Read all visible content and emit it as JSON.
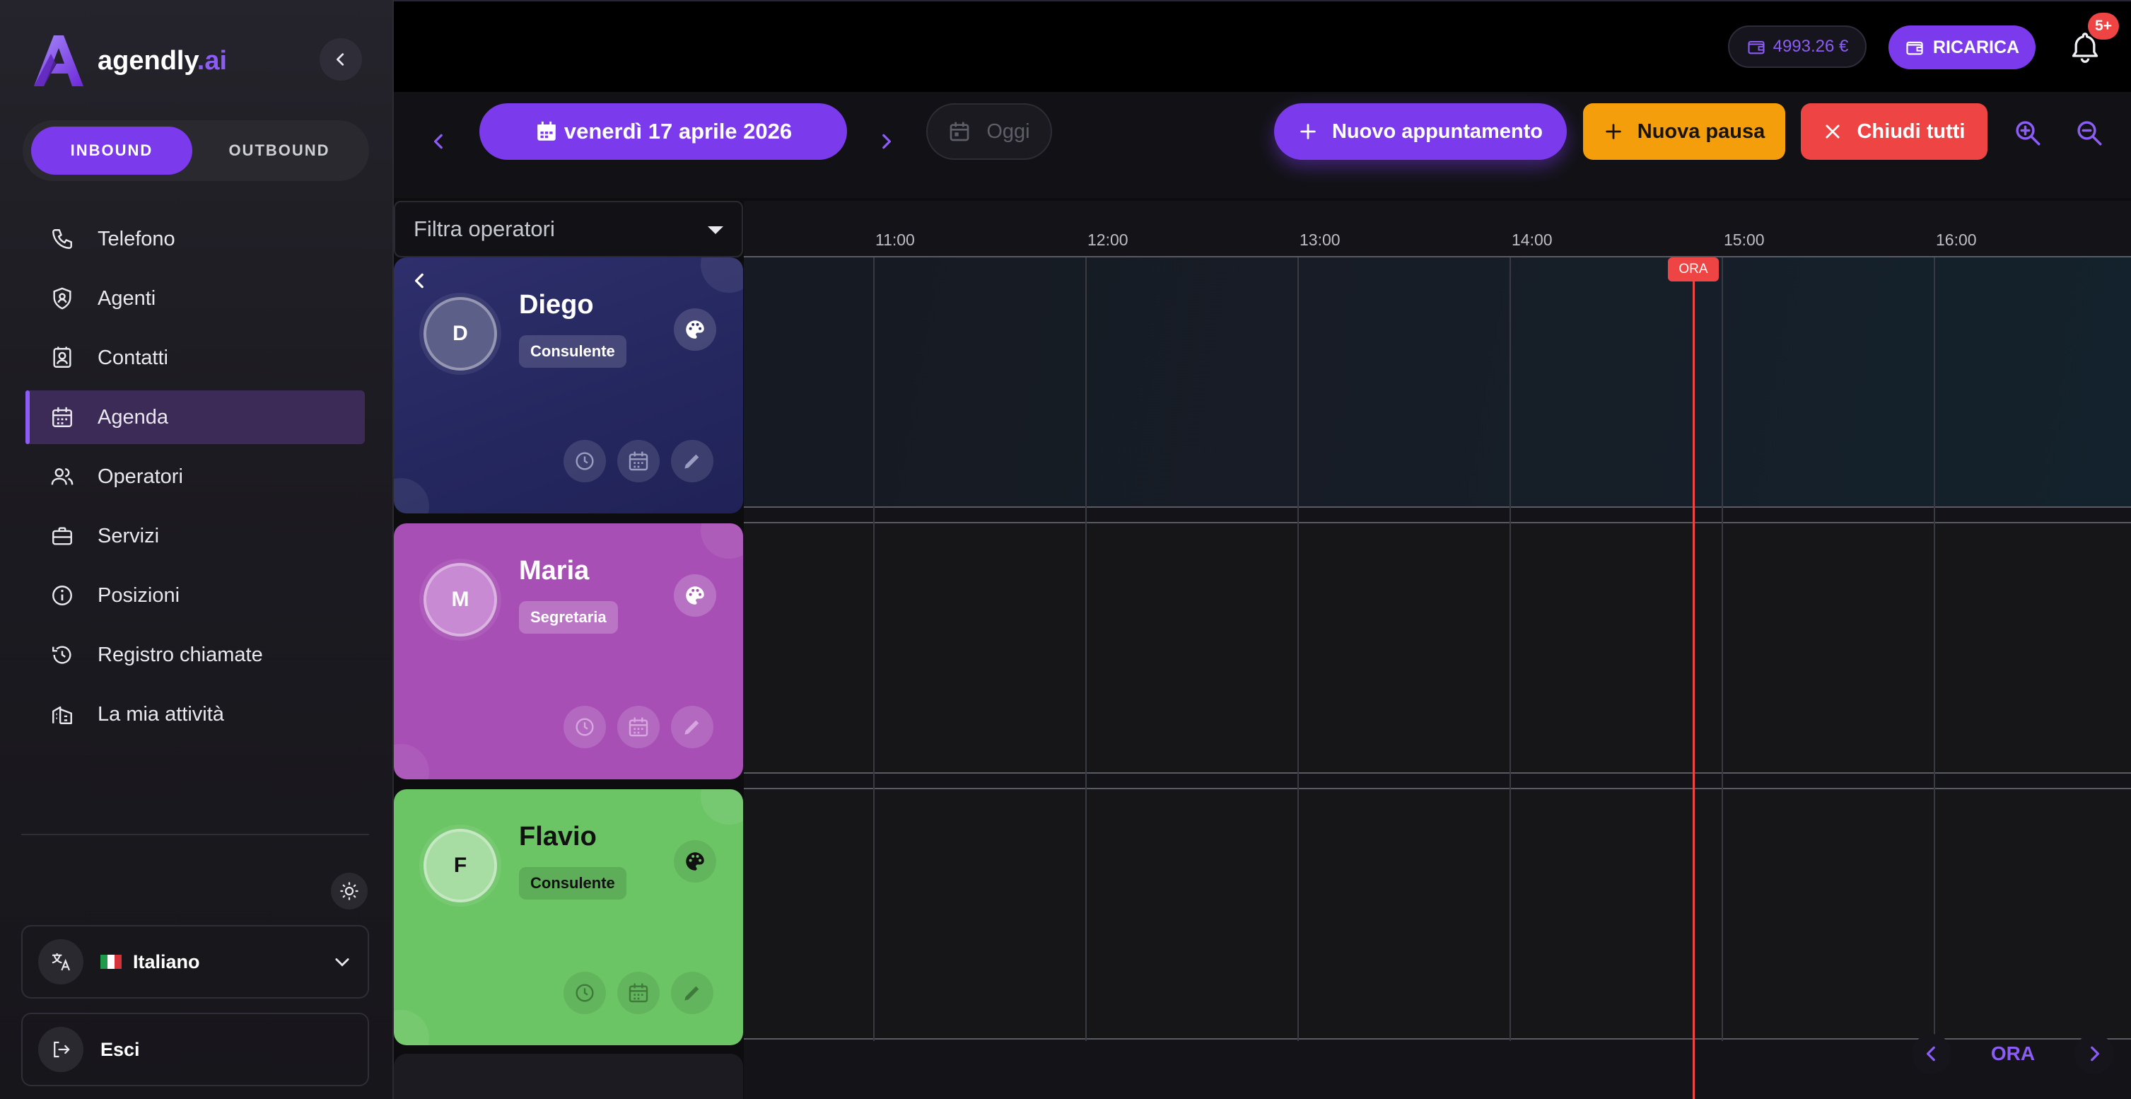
{
  "app": {
    "brand_name": "agendly",
    "brand_suffix": ".ai",
    "accent_color": "#7c3aed"
  },
  "sidebar": {
    "tabs": [
      {
        "label": "INBOUND",
        "active": true
      },
      {
        "label": "OUTBOUND",
        "active": false
      }
    ],
    "items": [
      {
        "label": "Telefono",
        "icon": "phone-icon"
      },
      {
        "label": "Agenti",
        "icon": "shield-user-icon"
      },
      {
        "label": "Contatti",
        "icon": "contact-book-icon"
      },
      {
        "label": "Agenda",
        "icon": "calendar-icon",
        "active": true
      },
      {
        "label": "Operatori",
        "icon": "users-icon"
      },
      {
        "label": "Servizi",
        "icon": "briefcase-icon"
      },
      {
        "label": "Posizioni",
        "icon": "info-circle-icon"
      },
      {
        "label": "Registro chiamate",
        "icon": "history-icon"
      },
      {
        "label": "La mia attività",
        "icon": "building-icon"
      }
    ],
    "language": {
      "label": "Italiano",
      "flag": "it-flag"
    },
    "logout_label": "Esci"
  },
  "topbar": {
    "balance": "4993.26 €",
    "recharge_label": "RICARICA",
    "notifications_badge": "5+"
  },
  "toolbar": {
    "date_label": "venerdì 17 aprile 2026",
    "today_label": "Oggi",
    "new_appointment_label": "Nuovo appuntamento",
    "new_pause_label": "Nuova pausa",
    "close_all_label": "Chiudi tutti"
  },
  "filter": {
    "placeholder": "Filtra operatori"
  },
  "timeline": {
    "hours": [
      "11:00",
      "12:00",
      "13:00",
      "14:00",
      "15:00",
      "16:00"
    ],
    "now_label": "ORA"
  },
  "operators": [
    {
      "initial": "D",
      "name": "Diego",
      "role": "Consulente"
    },
    {
      "initial": "M",
      "name": "Maria",
      "role": "Segretaria"
    },
    {
      "initial": "F",
      "name": "Flavio",
      "role": "Consulente"
    }
  ],
  "bottom_nav": {
    "label": "ORA"
  }
}
